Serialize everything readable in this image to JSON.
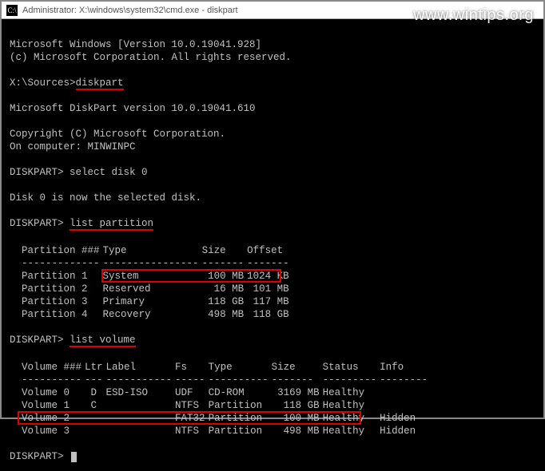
{
  "window": {
    "title": "Administrator: X:\\windows\\system32\\cmd.exe - diskpart"
  },
  "watermark": "www.wintips.org",
  "lines": {
    "l1": "Microsoft Windows [Version 10.0.19041.928]",
    "l2": "(c) Microsoft Corporation. All rights reserved.",
    "prompt1": "X:\\Sources>",
    "cmd1": "diskpart",
    "l3": "Microsoft DiskPart version 10.0.19041.610",
    "l4": "Copyright (C) Microsoft Corporation.",
    "l5": "On computer: MINWINPC",
    "prompt2": "DISKPART> ",
    "cmd2": "select disk 0",
    "l6": "Disk 0 is now the selected disk.",
    "prompt3": "DISKPART> ",
    "cmd3": "list partition",
    "prompt4": "DISKPART> ",
    "cmd4": "list volume",
    "prompt5": "DISKPART> "
  },
  "part_header": {
    "c1": "  Partition ###",
    "c2": "Type            ",
    "c3": "Size   ",
    "c4": "Offset"
  },
  "part_divider": {
    "c1": "  -------------",
    "c2": "----------------",
    "c3": "-------",
    "c4": "-------"
  },
  "partitions": [
    {
      "c1": "  Partition 1  ",
      "c2": "System          ",
      "c3": " 100 MB",
      "c4": "1024 KB"
    },
    {
      "c1": "  Partition 2  ",
      "c2": "Reserved        ",
      "c3": "  16 MB",
      "c4": " 101 MB"
    },
    {
      "c1": "  Partition 3  ",
      "c2": "Primary         ",
      "c3": " 118 GB",
      "c4": " 117 MB"
    },
    {
      "c1": "  Partition 4  ",
      "c2": "Recovery        ",
      "c3": " 498 MB",
      "c4": " 118 GB"
    }
  ],
  "vol_header": {
    "c1": "  Volume ###",
    "c2": "Ltr",
    "c3": "Label      ",
    "c4": "Fs   ",
    "c5": "Type      ",
    "c6": "Size    ",
    "c7": "Status   ",
    "c8": "Info"
  },
  "vol_divider": {
    "c1": "  ----------",
    "c2": "---",
    "c3": "-----------",
    "c4": "-----",
    "c5": "----------",
    "c6": "-------",
    "c7": "---------",
    "c8": "--------"
  },
  "volumes": [
    {
      "c1": "  Volume 0  ",
      "c2": " D ",
      "c3": "ESD-ISO    ",
      "c4": "UDF  ",
      "c5": "CD-ROM    ",
      "c6": " 3169 MB",
      "c7": "Healthy  ",
      "c8": ""
    },
    {
      "c1": "  Volume 1  ",
      "c2": " C ",
      "c3": "           ",
      "c4": "NTFS ",
      "c5": "Partition ",
      "c6": "  118 GB",
      "c7": "Healthy  ",
      "c8": ""
    },
    {
      "c1": "  Volume 2  ",
      "c2": "   ",
      "c3": "           ",
      "c4": "FAT32",
      "c5": "Partition ",
      "c6": "  100 MB",
      "c7": "Healthy  ",
      "c8": "Hidden"
    },
    {
      "c1": "  Volume 3  ",
      "c2": "   ",
      "c3": "           ",
      "c4": "NTFS ",
      "c5": "Partition ",
      "c6": "  498 MB",
      "c7": "Healthy  ",
      "c8": "Hidden"
    }
  ]
}
